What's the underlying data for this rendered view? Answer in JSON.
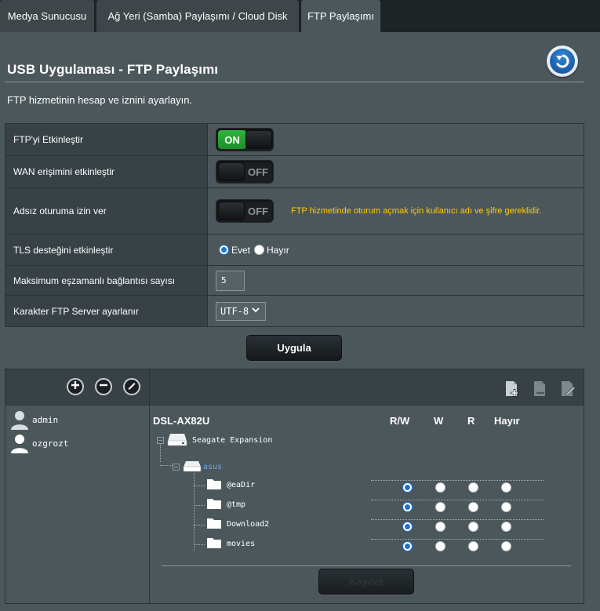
{
  "tabs": [
    {
      "label": "Medya Sunucusu",
      "active": false
    },
    {
      "label": "Ağ Yeri (Samba) Paylaşımı / Cloud Disk",
      "active": false
    },
    {
      "label": "FTP Paylaşımı",
      "active": true
    }
  ],
  "header": {
    "title": "USB Uygulaması - FTP Paylaşımı",
    "description": "FTP hizmetinin hesap ve iznini ayarlayın.",
    "back_icon": "back-arrow-icon"
  },
  "settings": {
    "enable_ftp": {
      "label": "FTP'yi Etkinleştir",
      "state": "ON"
    },
    "wan_access": {
      "label": "WAN erişimini etkinleştir",
      "state": "OFF"
    },
    "anonymous_login": {
      "label": "Adsız oturuma izin ver",
      "state": "OFF",
      "note": "FTP hizmetinde oturum açmak için kullanıcı adı ve şifre gereklidir."
    },
    "tls": {
      "label": "TLS desteğini etkinleştir",
      "options": [
        "Evet",
        "Hayır"
      ],
      "selected": "Evet"
    },
    "max_connections": {
      "label": "Maksimum eşzamanlı bağlantısı sayısı",
      "value": "5"
    },
    "charset": {
      "label": "Karakter FTP Server ayarlanır",
      "value": "UTF-8"
    }
  },
  "apply_label": "Uygula",
  "accounts": {
    "toolbar_icons": [
      "add-icon",
      "remove-icon",
      "edit-icon"
    ],
    "users": [
      "admin",
      "ozgrozt"
    ]
  },
  "permissions": {
    "toolbar_icons": [
      "add-folder-icon",
      "delete-folder-icon",
      "edit-folder-icon"
    ],
    "router_name": "DSL-AX82U",
    "columns": [
      "R/W",
      "W",
      "R",
      "Hayır"
    ],
    "disk": "Seagate Expansion",
    "partition": "asus",
    "folders": [
      {
        "name": "@eaDir",
        "selected": "R/W"
      },
      {
        "name": "@tmp",
        "selected": "R/W"
      },
      {
        "name": "Download2",
        "selected": "R/W"
      },
      {
        "name": "movies",
        "selected": "R/W"
      }
    ]
  },
  "save_label": "Kaydet",
  "colors": {
    "accent_blue": "#1f72d6",
    "toggle_on": "#2fb53a",
    "note_yellow": "#ffcc00",
    "link_blue": "#6fa9e0"
  }
}
